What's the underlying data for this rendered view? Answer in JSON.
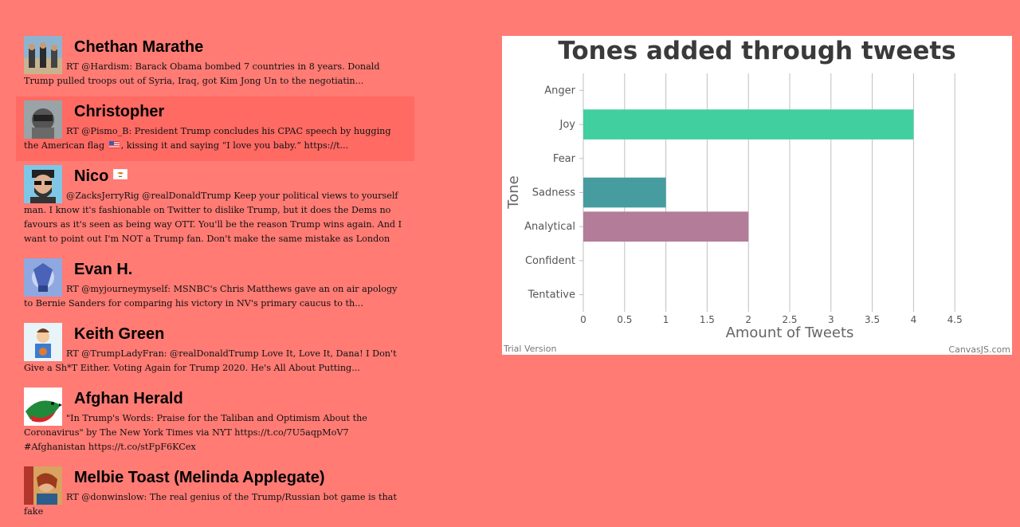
{
  "tweets": [
    {
      "name": "Chethan Marathe",
      "text": "RT @Hardism: Barack Obama bombed 7 countries in 8 years. Donald Trump pulled troops out of Syria, Iraq, got Kim Jong Un to the negotiatin...",
      "active": false
    },
    {
      "name": "Christopher",
      "text_before": "RT @Pismo_B: President Trump concludes his CPAC speech by hugging the American flag",
      "text_after": ", kissing it and saying “I love you baby.” https://t...",
      "active": true
    },
    {
      "name": "Nico",
      "text": "@ZacksJerryRig @realDonaldTrump Keep your political views to yourself man. I know it's fashionable on Twitter to dislike Trump, but it does the Dems no favours as it's seen as being way OTT. You'll be the reason Trump wins again. And I want to point out I'm NOT a Trump fan. Don't make the same mistake as London",
      "active": false
    },
    {
      "name": "Evan H.",
      "text": "RT @myjourneymyself: MSNBC's Chris Matthews gave an on air apology to Bernie Sanders for comparing his victory in NV's primary caucus to th...",
      "active": false
    },
    {
      "name": "Keith Green",
      "text": "RT @TrumpLadyFran: @realDonaldTrump Love It, Love It, Dana! I Don't Give a Sh*T Either. Voting Again for Trump 2020. He's All About Putting...",
      "active": false
    },
    {
      "name": "Afghan Herald",
      "text": "\"In Trump's Words: Praise for the Taliban and Optimism About the Coronavirus\" by The New York Times via NYT https://t.co/7U5aqpMoV7 #Afghanistan https://t.co/stFpF6KCex",
      "active": false
    },
    {
      "name": "Melbie Toast (Melinda Applegate)",
      "text": "RT @donwinslow: The real genius of the Trump/Russian bot game is that fake",
      "active": false
    }
  ],
  "chart_data": {
    "type": "bar",
    "orientation": "horizontal",
    "title": "Tones added through tweets",
    "xlabel": "Amount of Tweets",
    "ylabel": "Tone",
    "categories": [
      "Anger",
      "Joy",
      "Fear",
      "Sadness",
      "Analytical",
      "Confident",
      "Tentative"
    ],
    "values": [
      0,
      4,
      0,
      1,
      2,
      0,
      0
    ],
    "colors": [
      "#4f81bc",
      "#41cfa0",
      "#c0504e",
      "#469c9e",
      "#b37c98",
      "#9bbb58",
      "#f79647"
    ],
    "xlim": [
      0,
      4.5
    ],
    "xticks": [
      "0",
      "0.5",
      "1",
      "1.5",
      "2",
      "2.5",
      "3",
      "3.5",
      "4",
      "4.5"
    ],
    "grid": "vertical",
    "watermark_left": "Trial Version",
    "watermark_right": "CanvasJS.com"
  },
  "colors": {
    "background": "#ff7b74",
    "active_row": "#ff6a63"
  }
}
